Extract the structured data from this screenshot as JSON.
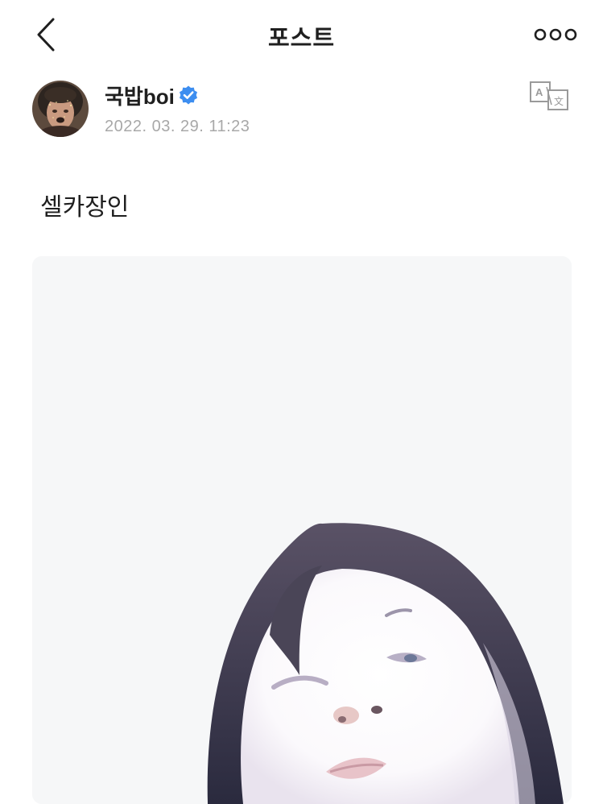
{
  "header": {
    "title": "포스트",
    "back_icon": "chevron-left-icon",
    "more_icon": "more-horizontal-icon"
  },
  "post": {
    "author_name": "국밥boi",
    "verified": true,
    "timestamp": "2022. 03. 29. 11:23",
    "text": "셀카장인",
    "translate_icon": "translate-icon",
    "image": "selfie-photo"
  },
  "colors": {
    "verified_badge": "#3d8ef0",
    "timestamp": "#a8a8a8",
    "icon_gray": "#9a9a9a"
  }
}
